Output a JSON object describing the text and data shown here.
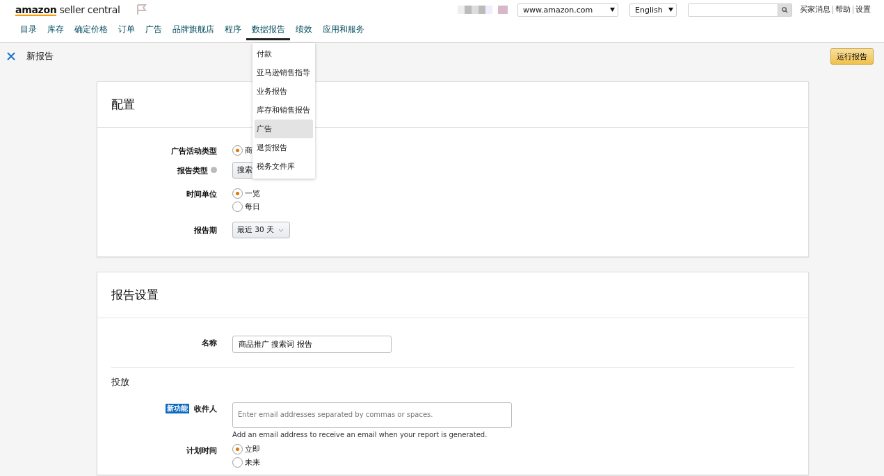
{
  "header": {
    "logo": {
      "brand": "amazon",
      "product": "seller central"
    },
    "marketplace": "www.amazon.com",
    "language": "English",
    "links": [
      "买家消息",
      "帮助",
      "设置"
    ]
  },
  "nav": [
    {
      "label": "目录",
      "selected": false
    },
    {
      "label": "库存",
      "selected": false
    },
    {
      "label": "确定价格",
      "selected": false
    },
    {
      "label": "订单",
      "selected": false
    },
    {
      "label": "广告",
      "selected": false
    },
    {
      "label": "品牌旗舰店",
      "selected": false
    },
    {
      "label": "程序",
      "selected": false
    },
    {
      "label": "数据报告",
      "selected": true
    },
    {
      "label": "绩效",
      "selected": false
    },
    {
      "label": "应用和服务",
      "selected": false
    }
  ],
  "dropdown": [
    {
      "label": "付款",
      "selected": false
    },
    {
      "label": "亚马逊销售指导",
      "selected": false
    },
    {
      "label": "业务报告",
      "selected": false
    },
    {
      "label": "库存和销售报告",
      "selected": false
    },
    {
      "label": "广告",
      "selected": true
    },
    {
      "label": "退货报告",
      "selected": false
    },
    {
      "label": "税务文件库",
      "selected": false
    }
  ],
  "subbar": {
    "title": "新报告",
    "run_button": "运行报告"
  },
  "config": {
    "title": "配置",
    "fields": [
      {
        "kind": "radio",
        "label": "广告活动类型",
        "options": [
          {
            "label": "商",
            "selected": true
          }
        ]
      },
      {
        "kind": "select",
        "label": "报告类型",
        "info": true,
        "value": "搜索"
      },
      {
        "kind": "radio",
        "label": "时间单位",
        "options": [
          {
            "label": "一览",
            "selected": true
          },
          {
            "label": "每日",
            "selected": false
          }
        ]
      },
      {
        "kind": "select",
        "label": "报告期",
        "info": false,
        "value": "最近 30 天"
      }
    ]
  },
  "settings": {
    "title": "报告设置",
    "name_label": "名称",
    "name_value": "商品推广 搜索词 报告",
    "delivery_title": "投放",
    "recipients": {
      "badge": "新功能",
      "label": "收件人",
      "placeholder": "Enter email addresses separated by commas or spaces.",
      "hint": "Add an email address to receive an email when your report is generated."
    },
    "schedule": {
      "label": "计划时间",
      "options": [
        {
          "label": "立即",
          "selected": true
        },
        {
          "label": "未来",
          "selected": false
        }
      ]
    }
  }
}
